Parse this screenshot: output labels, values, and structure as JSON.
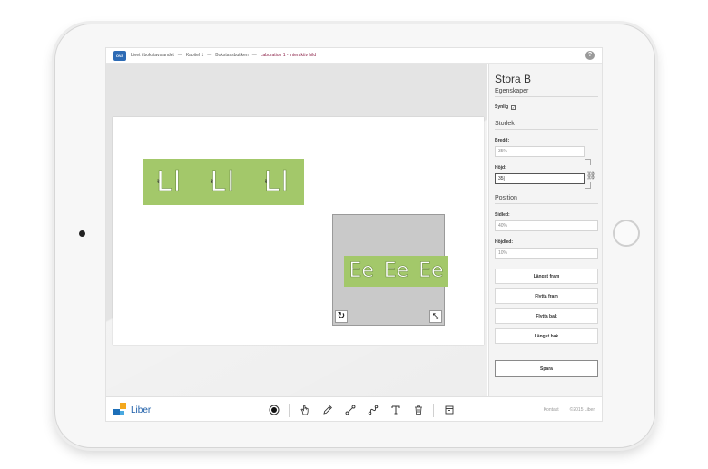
{
  "topbar": {
    "logo_text": "ÖVA",
    "breadcrumb": [
      "Livet i bokstavslandet",
      "Kapitel 1",
      "Bokstavsbutiken"
    ],
    "current": "Laboration 1 - interaktiv bild",
    "separator": "—",
    "help": "?"
  },
  "canvas": {
    "strip_l_letters": [
      "Ll",
      "Ll",
      "Ll"
    ],
    "strip_e_letters": [
      "Ee",
      "Ee",
      "Ee"
    ],
    "guide_1": "1",
    "guide_2": "2",
    "rotate_glyph": "↻",
    "resize_glyph": "⤡"
  },
  "panel": {
    "title": "Stora B",
    "properties_heading": "Egenskaper",
    "visible_label": "Synlig",
    "visible_checked": "✓",
    "size_heading": "Storlek",
    "width_label": "Bredd:",
    "width_value": "35%",
    "height_label": "Höjd:",
    "height_value": "35|",
    "position_heading": "Position",
    "x_label": "Sidled:",
    "x_value": "40%",
    "y_label": "Höjdled:",
    "y_value": "10%",
    "buttons": [
      "Längst fram",
      "Flytta fram",
      "Flytta bak",
      "Längst bak"
    ],
    "save": "Spara",
    "link_glyph": "⛓"
  },
  "bottombar": {
    "logo_text": "Liber",
    "footer_contact": "Kontakt",
    "footer_copyright": "©2015 Liber"
  },
  "colors": {
    "accent_current": "#8a1e45",
    "green_strip": "#a3c86a",
    "liber_blue": "#1d5ea8",
    "liber_orange": "#f4a81d"
  }
}
